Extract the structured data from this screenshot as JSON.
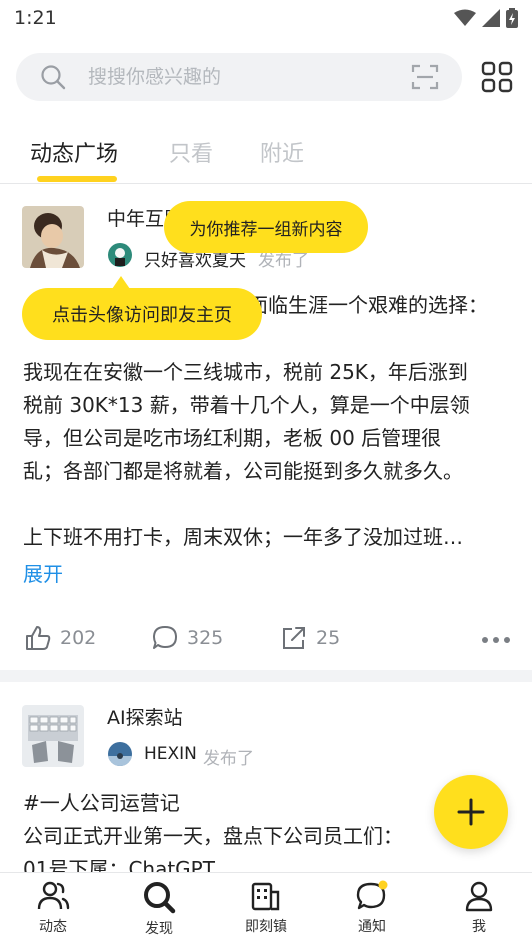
{
  "status_bar": {
    "time": "1:21"
  },
  "search": {
    "placeholder": "搜搜你感兴趣的"
  },
  "tabs": [
    {
      "label": "动态广场",
      "active": true
    },
    {
      "label": "只看",
      "active": false
    },
    {
      "label": "附近",
      "active": false
    }
  ],
  "tooltips": {
    "recommend": "为你推荐一组新内容",
    "avatar_hint": "点击头像访问即友主页"
  },
  "posts": [
    {
      "circle_name": "中年互助",
      "user_name": "只好喜欢夏天",
      "published_label": "发布了",
      "text_lines": [
        "面临生涯一个艰难的选择：",
        "我现在在安徽一个三线城市，税前 25K，年后涨到",
        "税前 30K*13 薪，带着十几个人，算是一个中层领",
        "导，但公司是吃市场红利期，老板 00 后管理很",
        "乱；各部门都是将就着，公司能挺到多久就多久。",
        "上下班不用打卡，周末双休；一年多了没加过班…"
      ],
      "expand_label": "展开",
      "likes": "202",
      "comments": "325",
      "shares": "25"
    },
    {
      "circle_name": "AI探索站",
      "user_name": "HEXIN",
      "published_label": "发布了",
      "text_lines": [
        "#一人公司运营记",
        "公司正式开业第一天，盘点下公司员工们：",
        "01号下属：ChatGPT"
      ]
    }
  ],
  "bottom_nav": [
    {
      "label": "动态",
      "icon": "people-icon"
    },
    {
      "label": "发现",
      "icon": "search-icon"
    },
    {
      "label": "即刻镇",
      "icon": "building-icon"
    },
    {
      "label": "通知",
      "icon": "chat-bubble-icon"
    },
    {
      "label": "我",
      "icon": "person-icon"
    }
  ],
  "colors": {
    "accent": "#ffdf1d",
    "link": "#1f8fe6",
    "muted": "#b0b3b8"
  }
}
